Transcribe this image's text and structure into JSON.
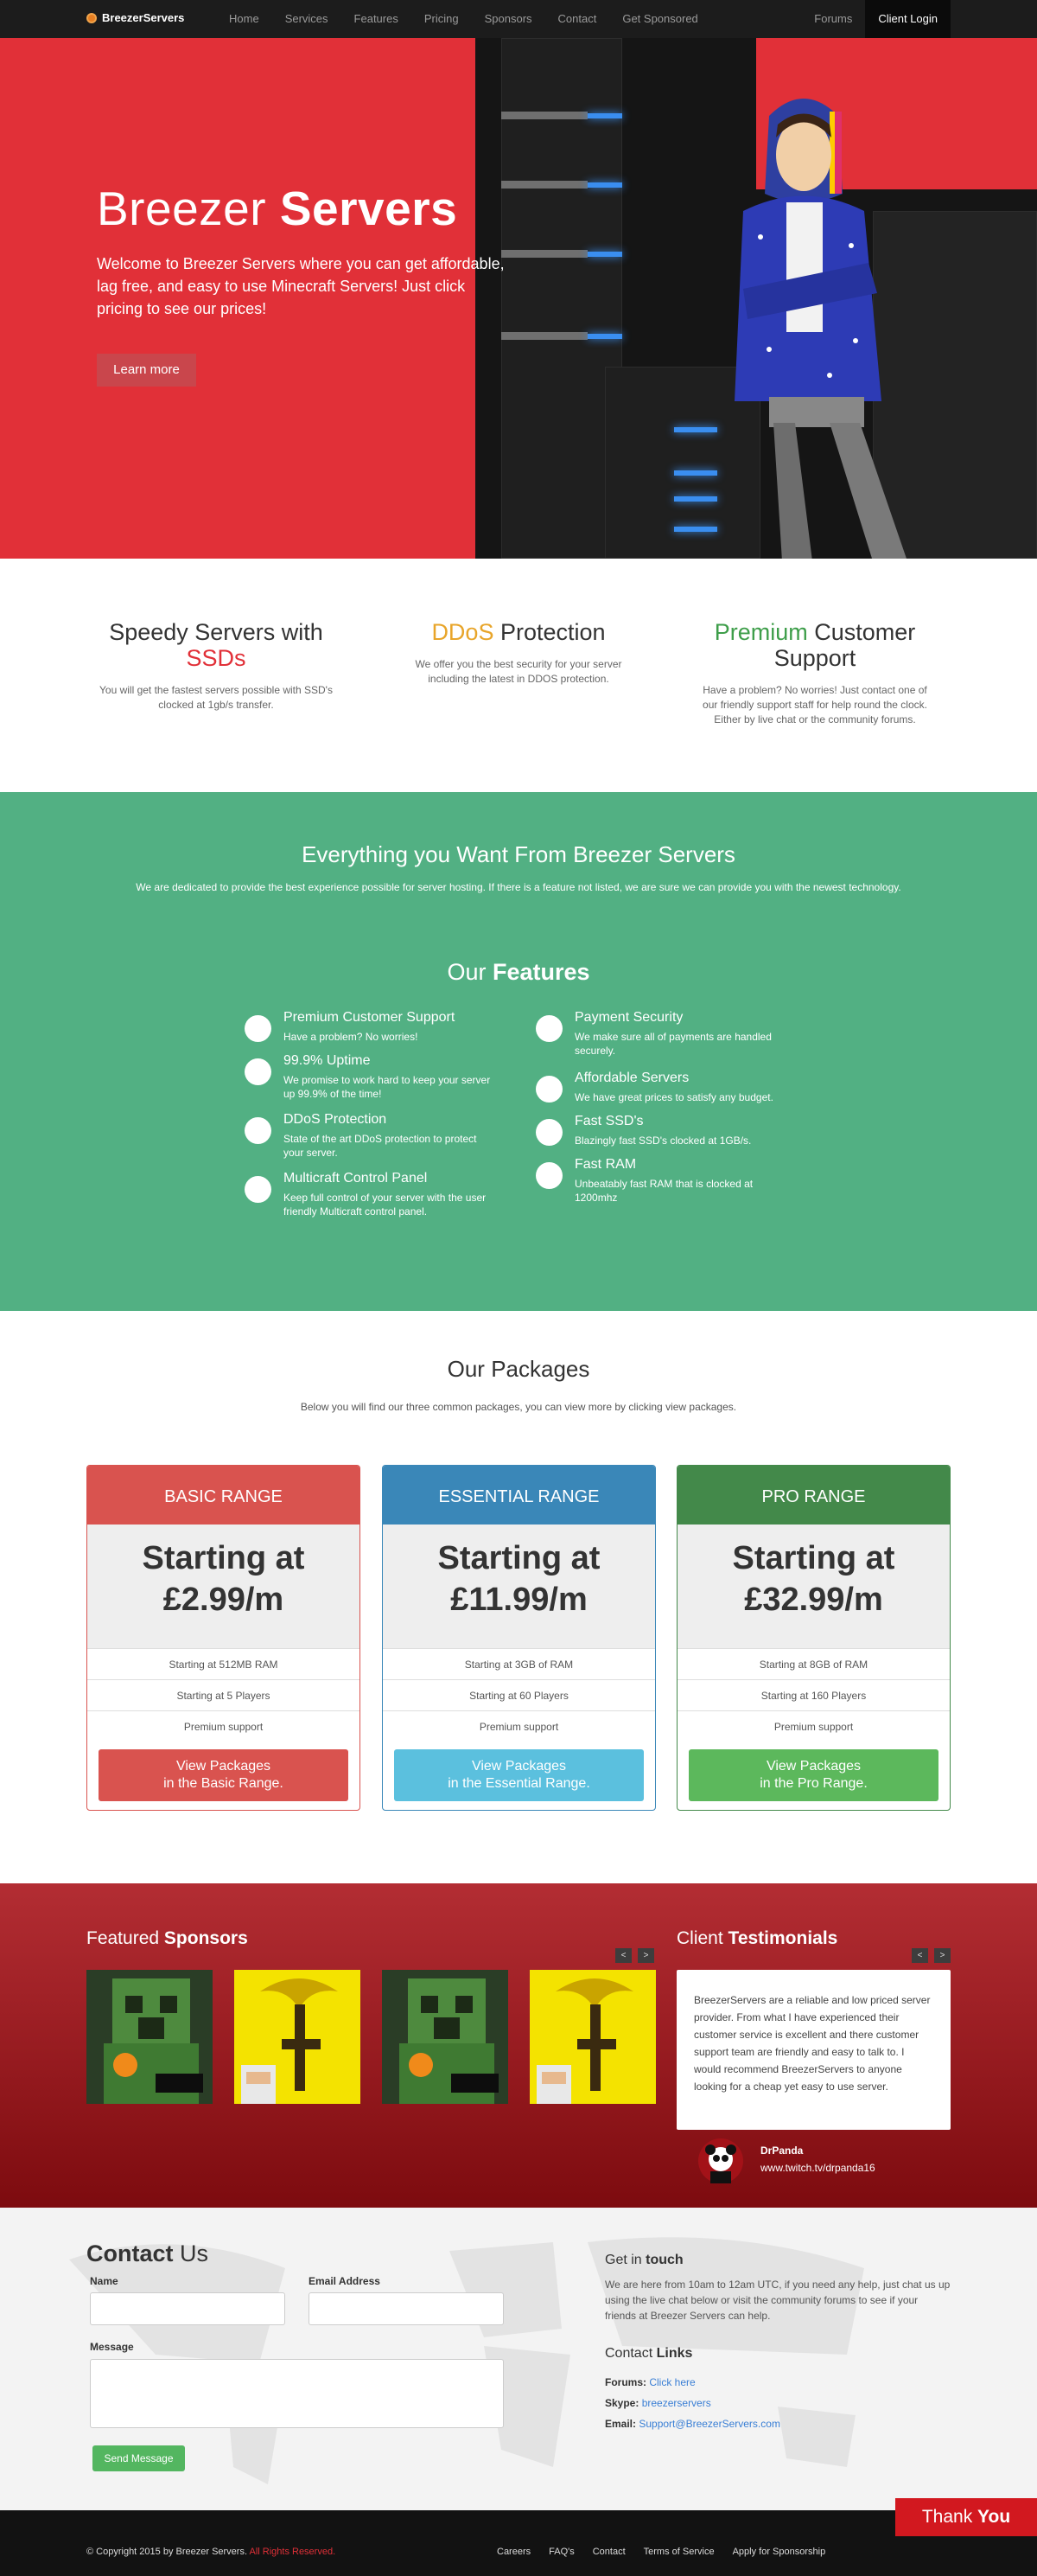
{
  "nav": {
    "brand": "BreezerServers",
    "items": [
      "Home",
      "Services",
      "Features",
      "Pricing",
      "Sponsors",
      "Contact",
      "Get Sponsored"
    ],
    "forums": "Forums",
    "login": "Client Login"
  },
  "hero": {
    "title_light": "Breezer",
    "title_bold": "Servers",
    "lead": "Welcome to Breezer Servers where you can get affordable, lag free, and easy to use Minecraft Servers! Just click pricing to see our prices!",
    "button": "Learn more"
  },
  "promo": [
    {
      "h_pre": "Speedy Servers with ",
      "h_hl": "SSDs",
      "h_post": "",
      "text": "You will get the fastest servers possible with SSD's clocked at 1gb/s transfer."
    },
    {
      "h_pre": "",
      "h_hl": "DDoS",
      "h_post": " Protection",
      "text": "We offer you the best security for your server including the latest in DDOS protection."
    },
    {
      "h_pre": "",
      "h_hl": "Premium",
      "h_post": " Customer Support",
      "text": "Have a problem? No worries! Just contact one of our friendly support staff for help round the clock. Either by live chat or the community forums."
    }
  ],
  "everything": {
    "title": "Everything you Want From Breezer Servers",
    "sub": "We are dedicated to provide the best experience possible for server hosting. If there is a feature not listed, we are sure we can provide you with the newest technology."
  },
  "features": {
    "title_pre": "Our",
    "title_bold": "Features",
    "items": [
      {
        "title": "Premium Customer Support",
        "text": "Have a problem? No worries!"
      },
      {
        "title": "99.9% Uptime",
        "text": "We promise to work hard to keep your server up 99.9% of the time!"
      },
      {
        "title": "DDoS Protection",
        "text": "State of the art DDoS protection to protect your server."
      },
      {
        "title": "Multicraft Control Panel",
        "text": "Keep full control of your server with the user friendly Multicraft control panel."
      },
      {
        "title": "Payment Security",
        "text": "We make sure all of payments are handled securely."
      },
      {
        "title": "Affordable Servers",
        "text": "We have great prices to satisfy any budget."
      },
      {
        "title": "Fast SSD's",
        "text": "Blazingly fast SSD's clocked at 1GB/s."
      },
      {
        "title": "Fast RAM",
        "text": "Unbeatably fast RAM that is clocked at 1200mhz"
      }
    ]
  },
  "packages": {
    "title": "Our Packages",
    "sub": "Below you will find our three common packages, you can view more by clicking view packages.",
    "cards": [
      {
        "name": "BASIC RANGE",
        "l1": "Starting at",
        "l2": "£2.99/m",
        "ram": "Starting at 512MB RAM",
        "players": "Starting at 5 Players",
        "support": "Premium support",
        "b1": "View Packages",
        "b2": "in the Basic Range.",
        "color": "#d9534f",
        "btn": "#d9534f"
      },
      {
        "name": "ESSENTIAL RANGE",
        "l1": "Starting at",
        "l2": "£11.99/m",
        "ram": "Starting at 3GB of RAM",
        "players": "Starting at 60 Players",
        "support": "Premium support",
        "b1": "View Packages",
        "b2": "in the Essential Range.",
        "color": "#3a87b8",
        "btn": "#5bc0de"
      },
      {
        "name": "PRO RANGE",
        "l1": "Starting at",
        "l2": "£32.99/m",
        "ram": "Starting at 8GB of RAM",
        "players": "Starting at 160 Players",
        "support": "Premium support",
        "b1": "View Packages",
        "b2": "in the Pro Range.",
        "color": "#43894a",
        "btn": "#5cb85c"
      }
    ]
  },
  "sponsors": {
    "title_pre": "Featured",
    "title_bold": "Sponsors",
    "prev": "<",
    "next": ">"
  },
  "testimonials": {
    "title_pre": "Client",
    "title_bold": "Testimonials",
    "prev": "<",
    "next": ">",
    "quote": "BreezerServers are a reliable and low priced server provider. From what I have experienced their customer service is excellent and there customer support team are friendly and easy to talk to. I would recommend BreezerServers to anyone looking for a cheap yet easy to use server.",
    "author": "DrPanda",
    "url": "www.twitch.tv/drpanda16"
  },
  "contact": {
    "title_bold": "Contact",
    "title_rest": "Us",
    "name": "Name",
    "email": "Email Address",
    "message": "Message",
    "send": "Send Message",
    "touch_pre": "Get in",
    "touch_bold": "touch",
    "touch_text": "We are here from 10am to 12am UTC, if you need any help, just chat us up using the live chat below or visit the community forums to see if your friends at Breezer Servers can help.",
    "links_pre": "Contact",
    "links_bold": "Links",
    "forums_label": "Forums:",
    "forums_val": "Click here",
    "skype_label": "Skype:",
    "skype_val": "breezerservers",
    "email_label": "Email:",
    "email_val": "Support@BreezerServers.com"
  },
  "footer": {
    "copy_pre": "© Copyright 2015 by Breezer Servers.",
    "copy_hl": "All Rights Reserved.",
    "links": [
      "Careers",
      "FAQ's",
      "Contact",
      "Terms of Service",
      "Apply for Sponsorship"
    ],
    "thanks_pre": "Thank",
    "thanks_bold": "You"
  }
}
